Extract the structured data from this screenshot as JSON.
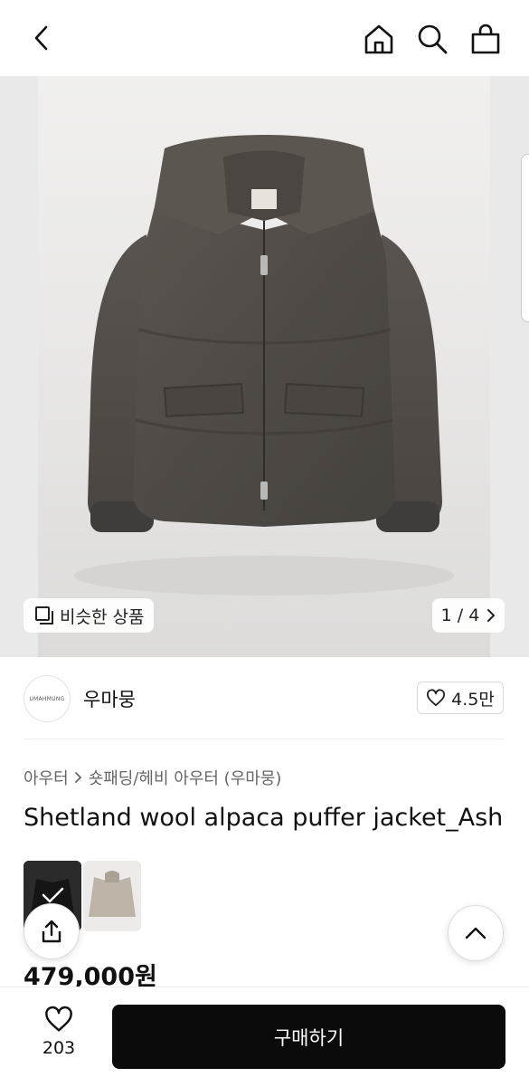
{
  "header": {
    "back_icon": "chevron-left-icon",
    "home_icon": "home-icon",
    "search_icon": "search-icon",
    "cart_icon": "shopping-bag-icon"
  },
  "gallery": {
    "similar_label": "비슷한 상품",
    "counter": "1 / 4",
    "current": 1,
    "total": 4
  },
  "brand": {
    "logo_text": "UMAHMUNG",
    "name": "우마뭉",
    "likes": "4.5만"
  },
  "breadcrumb": {
    "category": "아우터",
    "subcategory": "숏패딩/헤비 아우터 (우마뭉)"
  },
  "product": {
    "title": "Shetland wool alpaca puffer jacket_Ash",
    "price": "479,000원",
    "color_options": [
      "charcoal",
      "beige"
    ],
    "selected_option": 0
  },
  "bottom_bar": {
    "wish_count": "203",
    "buy_label": "구매하기"
  },
  "colors": {
    "primary": "#0b0b0b",
    "text": "#111111",
    "muted": "#666666"
  }
}
